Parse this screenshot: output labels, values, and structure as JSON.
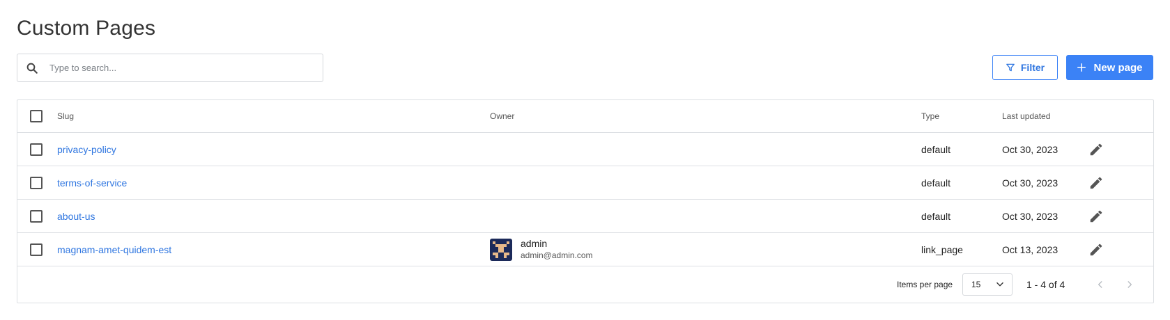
{
  "page": {
    "title": "Custom Pages"
  },
  "search": {
    "placeholder": "Type to search..."
  },
  "toolbar": {
    "filter_label": "Filter",
    "new_label": "New page"
  },
  "table": {
    "headers": {
      "slug": "Slug",
      "owner": "Owner",
      "type": "Type",
      "updated": "Last updated"
    },
    "rows": [
      {
        "slug": "privacy-policy",
        "owner_name": "",
        "owner_email": "",
        "type": "default",
        "updated": "Oct 30, 2023"
      },
      {
        "slug": "terms-of-service",
        "owner_name": "",
        "owner_email": "",
        "type": "default",
        "updated": "Oct 30, 2023"
      },
      {
        "slug": "about-us",
        "owner_name": "",
        "owner_email": "",
        "type": "default",
        "updated": "Oct 30, 2023"
      },
      {
        "slug": "magnam-amet-quidem-est",
        "owner_name": "admin",
        "owner_email": "admin@admin.com",
        "type": "link_page",
        "updated": "Oct 13, 2023"
      }
    ]
  },
  "pagination": {
    "items_per_page_label": "Items per page",
    "items_per_page": "15",
    "range": "1 - 4 of 4"
  },
  "icons": {
    "search": "search-icon",
    "filter": "filter-icon",
    "plus": "plus-icon",
    "edit": "pencil-icon",
    "chevron_down": "chevron-down-icon",
    "prev": "chevron-left-icon",
    "next": "chevron-right-icon"
  },
  "colors": {
    "accent": "#3b82f6",
    "link": "#2f76e0",
    "border": "#dcdfe3",
    "avatar_bg": "#1c2a5a",
    "avatar_fg": "#e8b98a"
  }
}
